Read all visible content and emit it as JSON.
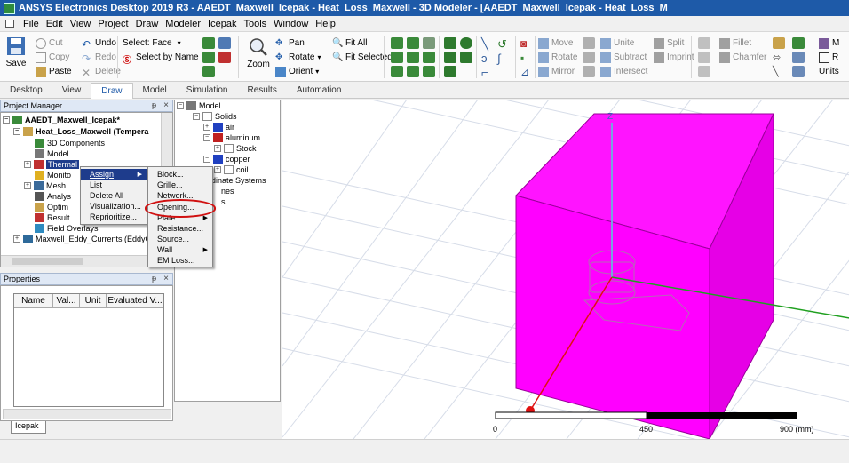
{
  "window": {
    "title": "ANSYS Electronics Desktop 2019 R3 - AAEDT_Maxwell_Icepak - Heat_Loss_Maxwell - 3D Modeler - [AAEDT_Maxwell_Icepak - Heat_Loss_M"
  },
  "menubar": [
    "File",
    "Edit",
    "View",
    "Project",
    "Draw",
    "Modeler",
    "Icepak",
    "Tools",
    "Window",
    "Help"
  ],
  "ribbon": {
    "save": "Save",
    "cut": "Cut",
    "copy": "Copy",
    "paste": "Paste",
    "undo": "Undo",
    "redo": "Redo",
    "delete": "Delete",
    "select_face": "Select: Face",
    "select_by_name": "Select by Name",
    "zoom": "Zoom",
    "pan": "Pan",
    "rotate": "Rotate",
    "orient": "Orient",
    "fit_all": "Fit All",
    "fit_selected": "Fit Selected",
    "move": "Move",
    "rotate2": "Rotate",
    "mirror": "Mirror",
    "unite": "Unite",
    "subtract": "Subtract",
    "intersect": "Intersect",
    "split": "Split",
    "imprint": "Imprint",
    "fillet": "Fillet",
    "chamfer": "Chamfer",
    "units": "Units",
    "m_trunc": "M",
    "r_trunc": "R"
  },
  "tabs": [
    "Desktop",
    "View",
    "Draw",
    "Model",
    "Simulation",
    "Results",
    "Automation"
  ],
  "active_tab": "Draw",
  "project_manager": {
    "title": "Project Manager",
    "project": "AAEDT_Maxwell_Icepak*",
    "design": "Heat_Loss_Maxwell (Tempera",
    "items": [
      "3D Components",
      "Model",
      "Thermal",
      "Monito",
      "Mesh",
      "Analys",
      "Optim",
      "Result",
      "Field Overlays"
    ],
    "design2": "Maxwell_Eddy_Currents (EddyC"
  },
  "model_tree": {
    "root": "Model",
    "solids": "Solids",
    "air": "air",
    "aluminum": "aluminum",
    "stock": "Stock",
    "copper": "copper",
    "coil": "coil",
    "coord_trunc": "rdinate Systems",
    "planes_trunc": "nes",
    "lists_trunc": "s"
  },
  "thermal_menu": [
    "Assign",
    "List",
    "Delete All",
    "Visualization...",
    "Reprioritize..."
  ],
  "assign_submenu": [
    "Block...",
    "Grille...",
    "Network...",
    "Opening...",
    "Plate",
    "Resistance...",
    "Source...",
    "Wall",
    "EM Loss..."
  ],
  "properties": {
    "title": "Properties",
    "columns": [
      "Name",
      "Val...",
      "Unit",
      "Evaluated V..."
    ]
  },
  "bottom_tab": "Icepak",
  "viewport": {
    "axis_z": "Z",
    "scale_labels": [
      "0",
      "450",
      "900 (mm)"
    ],
    "box_color": "#ff00ff"
  },
  "colors": {
    "accent": "#1e5aa8",
    "highlight_ring": "#d01010"
  }
}
